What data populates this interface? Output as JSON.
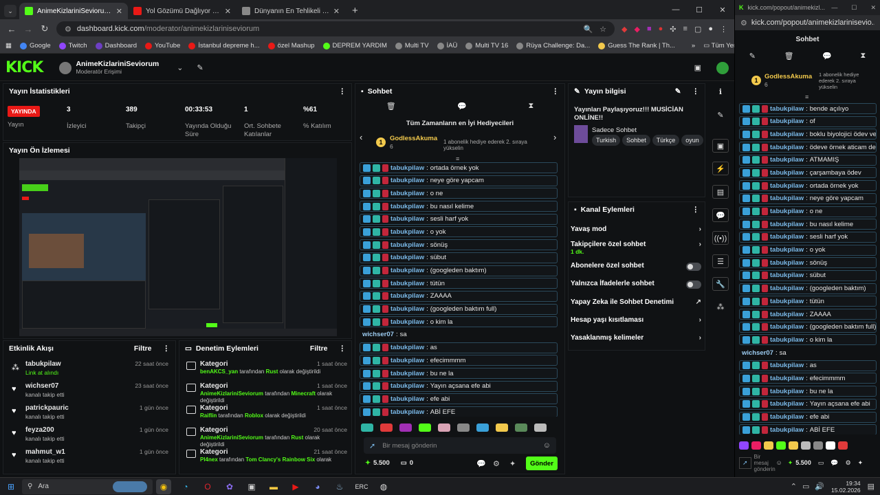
{
  "browser": {
    "tabs": [
      {
        "title": "AnimeKizlariniSeviorum Stream",
        "color": "#53fc18"
      },
      {
        "title": "Yol Gözümü Dağlıyor | You",
        "color": "#e91916"
      },
      {
        "title": "Dünyanın En Tehlikeli Yolları - T",
        "color": "#888888"
      }
    ],
    "url_host": "dashboard.kick.com",
    "url_path": "/moderator/animekizlariniseviorum",
    "bookmarks": [
      "Google",
      "Twitch",
      "Dashboard",
      "YouTube",
      "İstanbul depreme h...",
      "özel Mashup",
      "DEPREM YARDIM",
      "Multi TV",
      "İAÜ",
      "Multi TV 16",
      "Rüya Challenge: Da...",
      "Guess The Rank | Th..."
    ],
    "bookmarks_all": "Tüm Yer İşaretleri"
  },
  "header": {
    "logo": "KICK",
    "channel": "AnimeKizlariniSeviorum",
    "role": "Moderatör Erişimi"
  },
  "stats": {
    "title": "Yayın İstatistikleri",
    "live_badge": "YAYINDA",
    "items": [
      {
        "value": "",
        "label": "Yayın"
      },
      {
        "value": "3",
        "label": "İzleyici"
      },
      {
        "value": "389",
        "label": "Takipçi"
      },
      {
        "value": "00:33:53",
        "label": "Yayında Olduğu Süre"
      },
      {
        "value": "1",
        "label": "Ort. Sohbete Katılanlar"
      },
      {
        "value": "%61",
        "label": "% Katılım"
      }
    ]
  },
  "preview": {
    "title": "Yayın Ön İzlemesi"
  },
  "activity": {
    "title": "Etkinlik Akışı",
    "filter": "Filtre",
    "items": [
      {
        "name": "tabukpilaw",
        "sub": "Link at alındı",
        "time": "22 saat önce",
        "sub_green": true
      },
      {
        "name": "wichser07",
        "sub": "kanalı takip etti",
        "time": "23 saat önce"
      },
      {
        "name": "patrickpauric",
        "sub": "kanalı takip etti",
        "time": "1 gün önce"
      },
      {
        "name": "feyza200",
        "sub": "kanalı takip etti",
        "time": "1 gün önce"
      },
      {
        "name": "mahmut_w1",
        "sub": "kanalı takip etti",
        "time": "1 gün önce"
      }
    ]
  },
  "modlog": {
    "title": "Denetim Eylemleri",
    "filter": "Filtre",
    "items": [
      {
        "title": "Kategori",
        "user": "benAKCS_yan",
        "mid": " tarafından ",
        "cat": "Rust",
        "end": " olarak değiştirildi",
        "time": "1 saat önce"
      },
      {
        "title": "Kategori",
        "user": "AnimeKizlariniSeviorum",
        "mid": " tarafından ",
        "cat": "Minecraft",
        "end": " olarak değiştirildi",
        "time": "1 saat önce"
      },
      {
        "title": "Kategori",
        "user": "Raiflin",
        "mid": " tarafından ",
        "cat": "Roblox",
        "end": " olarak değiştirildi",
        "time": "1 saat önce"
      },
      {
        "title": "Kategori",
        "user": "AnimeKizlariniSeviorum",
        "mid": " tarafından ",
        "cat": "Rust",
        "end": " olarak değiştirildi",
        "time": "20 saat önce"
      },
      {
        "title": "Kategori",
        "user": "Pl4nex",
        "mid": " tarafından ",
        "cat": "Tom Clancy's Rainbow Six",
        "end": " olarak",
        "time": "21 saat önce"
      }
    ]
  },
  "chat": {
    "title": "Sohbet",
    "top_gifters": "Tüm Zamanların en İyi Hediyecileri",
    "gifter_name": "GodlessAkuma",
    "gifter_count": "6",
    "gifter_hint": "1 abonelik hediye ederek 2. sıraya yükselin",
    "messages": [
      {
        "user": "tabukpilaw",
        "text": "ortada örnek yok"
      },
      {
        "user": "tabukpilaw",
        "text": "neye göre yapcam"
      },
      {
        "user": "tabukpilaw",
        "text": "o ne"
      },
      {
        "user": "tabukpilaw",
        "text": "bu nasıl kelime"
      },
      {
        "user": "tabukpilaw",
        "text": "sesli harf yok"
      },
      {
        "user": "tabukpilaw",
        "text": "o yok"
      },
      {
        "user": "tabukpilaw",
        "text": "sönüş"
      },
      {
        "user": "tabukpilaw",
        "text": "sübut"
      },
      {
        "user": "tabukpilaw",
        "text": "(googleden baktım)"
      },
      {
        "user": "tabukpilaw",
        "text": "tütün"
      },
      {
        "user": "tabukpilaw",
        "text": "ZAAAA"
      },
      {
        "user": "tabukpilaw",
        "text": "(googleden baktım full)"
      },
      {
        "user": "tabukpilaw",
        "text": "o kim la"
      },
      {
        "user": "wichser07",
        "text": "sa",
        "plain": true
      },
      {
        "user": "tabukpilaw",
        "text": "as"
      },
      {
        "user": "tabukpilaw",
        "text": "efecimmmm"
      },
      {
        "user": "tabukpilaw",
        "text": "bu ne la"
      },
      {
        "user": "tabukpilaw",
        "text": "Yayın açsana efe abi"
      },
      {
        "user": "tabukpilaw",
        "text": "efe abi"
      },
      {
        "user": "tabukpilaw",
        "text": "ABİ EFE"
      }
    ],
    "input_placeholder": "Bir mesaj gönderin",
    "points": "5.500",
    "count": "0",
    "send": "Gönder"
  },
  "info": {
    "title": "Yayın bilgisi",
    "stream_title": "Yayınları Paylaşıyoruz!!! MUSİCİAN ONLİNE!!",
    "category": "Sadece Sohbet",
    "tags": [
      "Turkish",
      "Sohbet",
      "Türkçe",
      "oyun"
    ]
  },
  "channel_actions": {
    "title": "Kanal Eylemleri",
    "slow_mode": "Yavaş mod",
    "followers_only": "Takipçilere özel sohbet",
    "followers_only_sub": "1 dk.",
    "subs_only": "Abonelere özel sohbet",
    "emotes_only": "Yalnızca İfadelerle sohbet",
    "ai_moderation": "Yapay Zeka ile Sohbet Denetimi",
    "account_age": "Hesap yaşı kısıtlaması",
    "banned_words": "Yasaklanmış kelimeler"
  },
  "popup": {
    "top_url": "kick.com/popout/animekizl...",
    "addr": "kick.com/popout/animekizlariniseviо...",
    "title": "Sohbet",
    "gifter_name": "GodlessAkuma",
    "gifter_count": "6",
    "gifter_hint": "1 abonelik hediye ederek 2. sıraya yükselin",
    "messages": [
      {
        "user": "tabukpilaw",
        "text": "bende açılıyo"
      },
      {
        "user": "tabukpilaw",
        "text": "of"
      },
      {
        "user": "tabukpilaw",
        "text": "boklu biyolojici ödev verdi"
      },
      {
        "user": "tabukpilaw",
        "text": "ödeve örnek aticam dedi"
      },
      {
        "user": "tabukpilaw",
        "text": "ATMAMIŞ"
      },
      {
        "user": "tabukpilaw",
        "text": "çarşambaya ödev"
      },
      {
        "user": "tabukpilaw",
        "text": "ortada örnek yok"
      },
      {
        "user": "tabukpilaw",
        "text": "neye göre yapcam"
      },
      {
        "user": "tabukpilaw",
        "text": "o ne"
      },
      {
        "user": "tabukpilaw",
        "text": "bu nasıl kelime"
      },
      {
        "user": "tabukpilaw",
        "text": "sesli harf yok"
      },
      {
        "user": "tabukpilaw",
        "text": "o yok"
      },
      {
        "user": "tabukpilaw",
        "text": "sönüş"
      },
      {
        "user": "tabukpilaw",
        "text": "sübut"
      },
      {
        "user": "tabukpilaw",
        "text": "(googleden baktım)"
      },
      {
        "user": "tabukpilaw",
        "text": "tütün"
      },
      {
        "user": "tabukpilaw",
        "text": "ZAAAA"
      },
      {
        "user": "tabukpilaw",
        "text": "(googleden baktım full)"
      },
      {
        "user": "tabukpilaw",
        "text": "o kim la"
      },
      {
        "user": "wichser07",
        "text": "sa",
        "plain": true
      },
      {
        "user": "tabukpilaw",
        "text": "as"
      },
      {
        "user": "tabukpilaw",
        "text": "efecimmmm"
      },
      {
        "user": "tabukpilaw",
        "text": "bu ne la"
      },
      {
        "user": "tabukpilaw",
        "text": "Yayın açsana efe abi"
      },
      {
        "user": "tabukpilaw",
        "text": "efe abi"
      },
      {
        "user": "tabukpilaw",
        "text": "ABİ EFE"
      }
    ],
    "input_placeholder": "Bir mesaj gönderin",
    "points": "5.500"
  },
  "taskbar": {
    "search": "Ara",
    "time": "19:34",
    "date": "15.02.2026"
  },
  "colors": {
    "accent": "#53fc18",
    "live": "#e91916",
    "username": "#7ab9e8"
  }
}
